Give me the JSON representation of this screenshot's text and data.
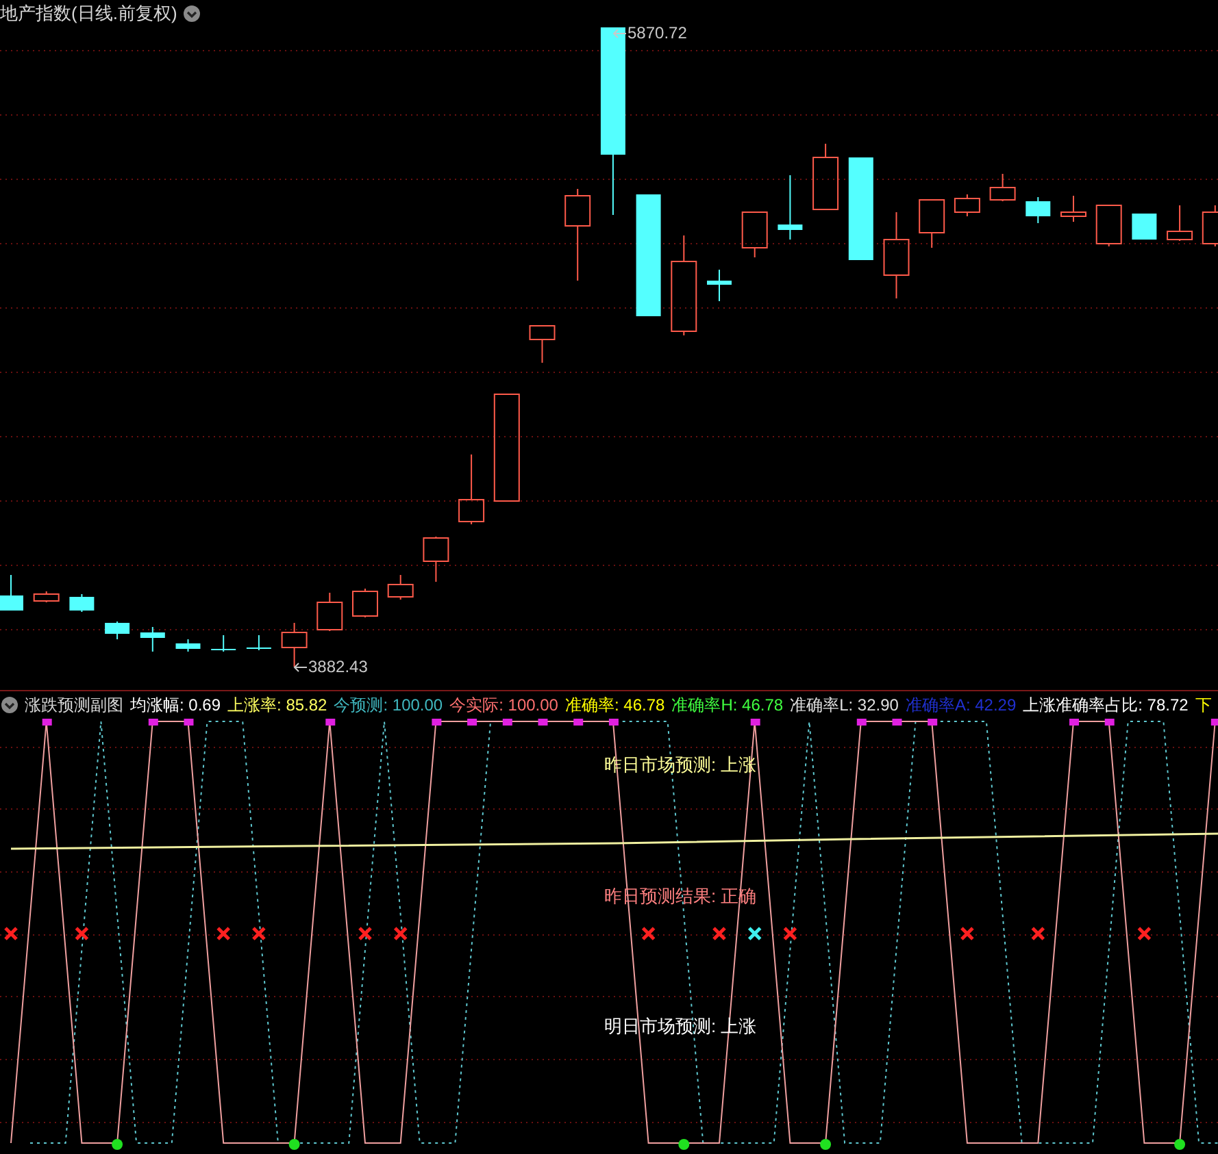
{
  "main_chart": {
    "title": "地产指数(日线.前复权)",
    "high_label": "5870.72",
    "low_label": "3882.43"
  },
  "indicator": {
    "title": "涨跌预测副图",
    "stats": [
      {
        "text": "均涨幅: 0.69",
        "color": "#ffffff"
      },
      {
        "text": "上涨率: 85.82",
        "color": "#ffff60"
      },
      {
        "text": "今预测: 100.00",
        "color": "#40b8c0"
      },
      {
        "text": "今实际: 100.00",
        "color": "#ff7070"
      },
      {
        "text": "准确率: 46.78",
        "color": "#ffff00"
      },
      {
        "text": "准确率H: 46.78",
        "color": "#40ff40"
      },
      {
        "text": "准确率L: 32.90",
        "color": "#e0e0e0"
      },
      {
        "text": "准确率A: 42.29",
        "color": "#2030d0"
      },
      {
        "text": "上涨准确率占比: 78.72",
        "color": "#ffffff"
      },
      {
        "text": "下",
        "color": "#ffff00"
      }
    ],
    "annotations": [
      {
        "text": "昨日市场预测: 上涨",
        "color": "#ffff99"
      },
      {
        "text": "昨日预测结果: 正确",
        "color": "#ff8080"
      },
      {
        "text": "明日市场预测: 上涨",
        "color": "#ffffff"
      }
    ]
  }
}
